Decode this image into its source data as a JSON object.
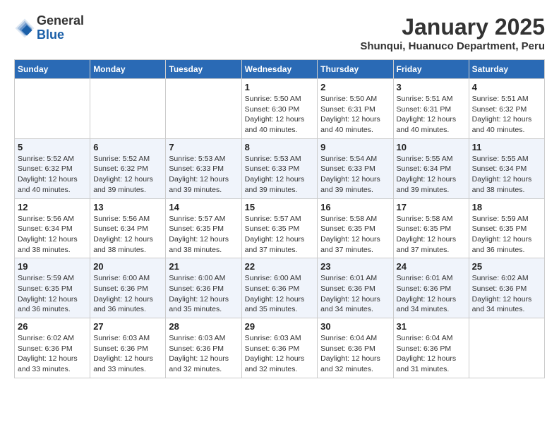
{
  "header": {
    "logo_general": "General",
    "logo_blue": "Blue",
    "title": "January 2025",
    "subtitle": "Shunqui, Huanuco Department, Peru"
  },
  "days_of_week": [
    "Sunday",
    "Monday",
    "Tuesday",
    "Wednesday",
    "Thursday",
    "Friday",
    "Saturday"
  ],
  "weeks": [
    [
      {
        "day": "",
        "info": ""
      },
      {
        "day": "",
        "info": ""
      },
      {
        "day": "",
        "info": ""
      },
      {
        "day": "1",
        "info": "Sunrise: 5:50 AM\nSunset: 6:30 PM\nDaylight: 12 hours\nand 40 minutes."
      },
      {
        "day": "2",
        "info": "Sunrise: 5:50 AM\nSunset: 6:31 PM\nDaylight: 12 hours\nand 40 minutes."
      },
      {
        "day": "3",
        "info": "Sunrise: 5:51 AM\nSunset: 6:31 PM\nDaylight: 12 hours\nand 40 minutes."
      },
      {
        "day": "4",
        "info": "Sunrise: 5:51 AM\nSunset: 6:32 PM\nDaylight: 12 hours\nand 40 minutes."
      }
    ],
    [
      {
        "day": "5",
        "info": "Sunrise: 5:52 AM\nSunset: 6:32 PM\nDaylight: 12 hours\nand 40 minutes."
      },
      {
        "day": "6",
        "info": "Sunrise: 5:52 AM\nSunset: 6:32 PM\nDaylight: 12 hours\nand 39 minutes."
      },
      {
        "day": "7",
        "info": "Sunrise: 5:53 AM\nSunset: 6:33 PM\nDaylight: 12 hours\nand 39 minutes."
      },
      {
        "day": "8",
        "info": "Sunrise: 5:53 AM\nSunset: 6:33 PM\nDaylight: 12 hours\nand 39 minutes."
      },
      {
        "day": "9",
        "info": "Sunrise: 5:54 AM\nSunset: 6:33 PM\nDaylight: 12 hours\nand 39 minutes."
      },
      {
        "day": "10",
        "info": "Sunrise: 5:55 AM\nSunset: 6:34 PM\nDaylight: 12 hours\nand 39 minutes."
      },
      {
        "day": "11",
        "info": "Sunrise: 5:55 AM\nSunset: 6:34 PM\nDaylight: 12 hours\nand 38 minutes."
      }
    ],
    [
      {
        "day": "12",
        "info": "Sunrise: 5:56 AM\nSunset: 6:34 PM\nDaylight: 12 hours\nand 38 minutes."
      },
      {
        "day": "13",
        "info": "Sunrise: 5:56 AM\nSunset: 6:34 PM\nDaylight: 12 hours\nand 38 minutes."
      },
      {
        "day": "14",
        "info": "Sunrise: 5:57 AM\nSunset: 6:35 PM\nDaylight: 12 hours\nand 38 minutes."
      },
      {
        "day": "15",
        "info": "Sunrise: 5:57 AM\nSunset: 6:35 PM\nDaylight: 12 hours\nand 37 minutes."
      },
      {
        "day": "16",
        "info": "Sunrise: 5:58 AM\nSunset: 6:35 PM\nDaylight: 12 hours\nand 37 minutes."
      },
      {
        "day": "17",
        "info": "Sunrise: 5:58 AM\nSunset: 6:35 PM\nDaylight: 12 hours\nand 37 minutes."
      },
      {
        "day": "18",
        "info": "Sunrise: 5:59 AM\nSunset: 6:35 PM\nDaylight: 12 hours\nand 36 minutes."
      }
    ],
    [
      {
        "day": "19",
        "info": "Sunrise: 5:59 AM\nSunset: 6:35 PM\nDaylight: 12 hours\nand 36 minutes."
      },
      {
        "day": "20",
        "info": "Sunrise: 6:00 AM\nSunset: 6:36 PM\nDaylight: 12 hours\nand 36 minutes."
      },
      {
        "day": "21",
        "info": "Sunrise: 6:00 AM\nSunset: 6:36 PM\nDaylight: 12 hours\nand 35 minutes."
      },
      {
        "day": "22",
        "info": "Sunrise: 6:00 AM\nSunset: 6:36 PM\nDaylight: 12 hours\nand 35 minutes."
      },
      {
        "day": "23",
        "info": "Sunrise: 6:01 AM\nSunset: 6:36 PM\nDaylight: 12 hours\nand 34 minutes."
      },
      {
        "day": "24",
        "info": "Sunrise: 6:01 AM\nSunset: 6:36 PM\nDaylight: 12 hours\nand 34 minutes."
      },
      {
        "day": "25",
        "info": "Sunrise: 6:02 AM\nSunset: 6:36 PM\nDaylight: 12 hours\nand 34 minutes."
      }
    ],
    [
      {
        "day": "26",
        "info": "Sunrise: 6:02 AM\nSunset: 6:36 PM\nDaylight: 12 hours\nand 33 minutes."
      },
      {
        "day": "27",
        "info": "Sunrise: 6:03 AM\nSunset: 6:36 PM\nDaylight: 12 hours\nand 33 minutes."
      },
      {
        "day": "28",
        "info": "Sunrise: 6:03 AM\nSunset: 6:36 PM\nDaylight: 12 hours\nand 32 minutes."
      },
      {
        "day": "29",
        "info": "Sunrise: 6:03 AM\nSunset: 6:36 PM\nDaylight: 12 hours\nand 32 minutes."
      },
      {
        "day": "30",
        "info": "Sunrise: 6:04 AM\nSunset: 6:36 PM\nDaylight: 12 hours\nand 32 minutes."
      },
      {
        "day": "31",
        "info": "Sunrise: 6:04 AM\nSunset: 6:36 PM\nDaylight: 12 hours\nand 31 minutes."
      },
      {
        "day": "",
        "info": ""
      }
    ]
  ]
}
